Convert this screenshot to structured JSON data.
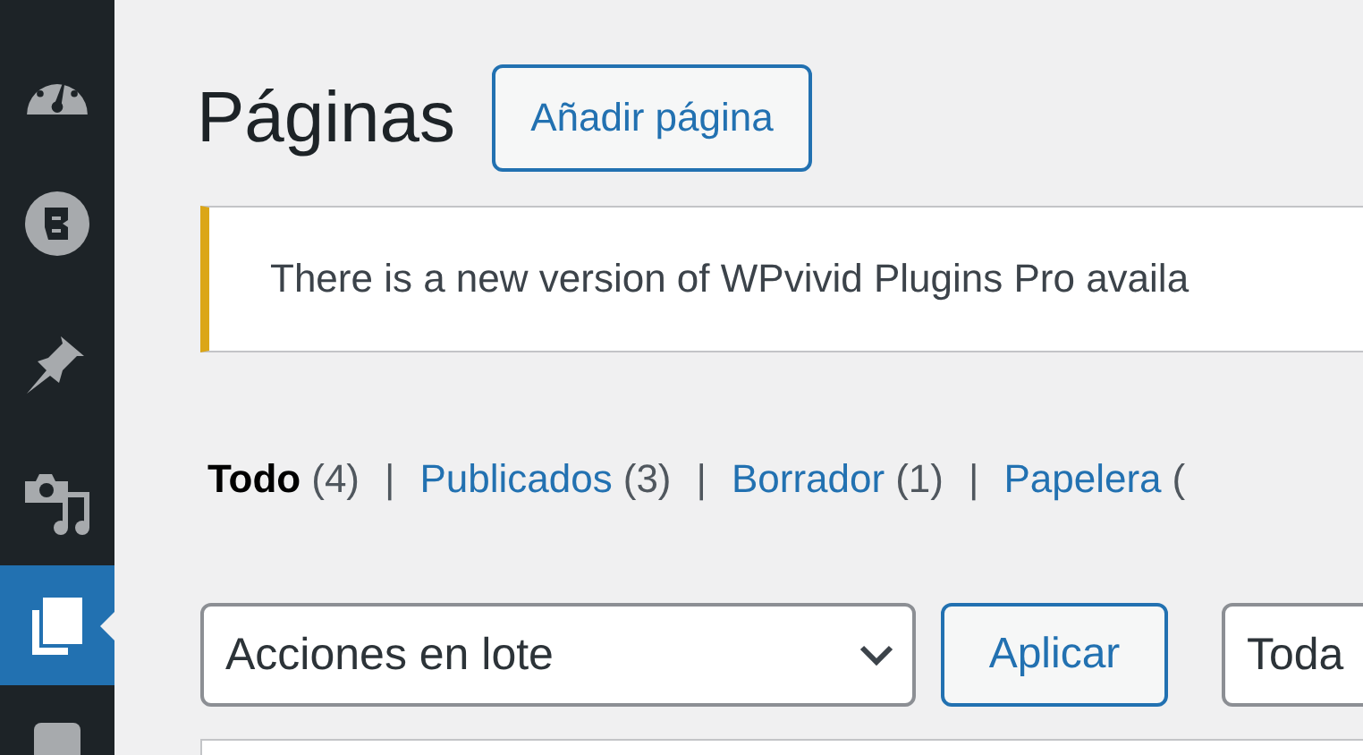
{
  "sidebar": {
    "items": [
      {
        "kind": "dashboard",
        "selected": false
      },
      {
        "kind": "builder",
        "selected": false
      },
      {
        "kind": "pin",
        "selected": false
      },
      {
        "kind": "media",
        "selected": false
      },
      {
        "kind": "pages",
        "selected": true
      },
      {
        "kind": "square",
        "selected": false
      }
    ]
  },
  "header": {
    "title": "Páginas",
    "add_button": "Añadir página"
  },
  "notice": {
    "text": "There is a new version of WPvivid Plugins Pro availa"
  },
  "filters": [
    {
      "label": "Todo",
      "count": "(4)",
      "selected": true
    },
    {
      "label": "Publicados",
      "count": "(3)",
      "selected": false
    },
    {
      "label": "Borrador",
      "count": "(1)",
      "selected": false
    },
    {
      "label": "Papelera",
      "count": "(",
      "selected": false
    }
  ],
  "filter_separator": "|",
  "bulk_actions": {
    "value": "Acciones en lote",
    "apply_button": "Aplicar"
  },
  "date_filter": {
    "value": "Toda"
  }
}
